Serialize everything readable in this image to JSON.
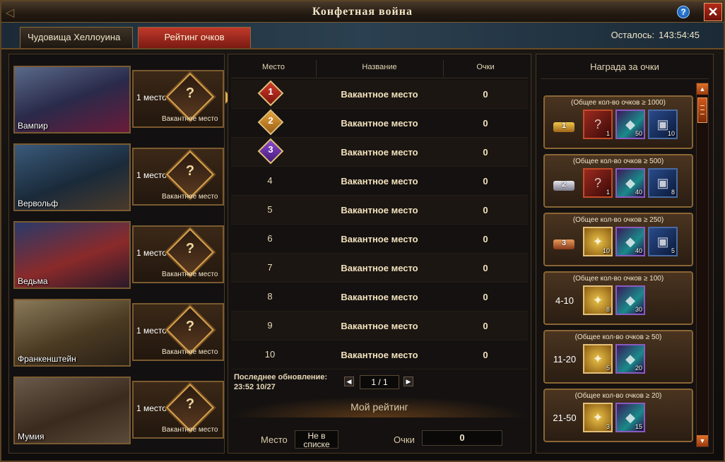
{
  "window": {
    "title": "Конфетная война"
  },
  "tabs": {
    "monsters": "Чудовища Хеллоуина",
    "rating": "Рейтинг очков"
  },
  "remaining": {
    "label": "Осталось:",
    "value": "143:54:45"
  },
  "monsters": [
    {
      "name": "Вампир",
      "place": "1 место",
      "status": "Вакантное место",
      "mark": "?"
    },
    {
      "name": "Вервольф",
      "place": "1 место",
      "status": "Вакантное место",
      "mark": "?"
    },
    {
      "name": "Ведьма",
      "place": "1 место",
      "status": "Вакантное место",
      "mark": "?"
    },
    {
      "name": "Франкенштейн",
      "place": "1 место",
      "status": "Вакантное место",
      "mark": "?"
    },
    {
      "name": "Мумия",
      "place": "1 место",
      "status": "Вакантное место",
      "mark": "?"
    }
  ],
  "table": {
    "headers": {
      "place": "Место",
      "name": "Название",
      "score": "Очки"
    },
    "rows": [
      {
        "rank": "1",
        "name": "Вакантное место",
        "score": "0"
      },
      {
        "rank": "2",
        "name": "Вакантное место",
        "score": "0"
      },
      {
        "rank": "3",
        "name": "Вакантное место",
        "score": "0"
      },
      {
        "rank": "4",
        "name": "Вакантное место",
        "score": "0"
      },
      {
        "rank": "5",
        "name": "Вакантное место",
        "score": "0"
      },
      {
        "rank": "6",
        "name": "Вакантное место",
        "score": "0"
      },
      {
        "rank": "7",
        "name": "Вакантное место",
        "score": "0"
      },
      {
        "rank": "8",
        "name": "Вакантное место",
        "score": "0"
      },
      {
        "rank": "9",
        "name": "Вакантное место",
        "score": "0"
      },
      {
        "rank": "10",
        "name": "Вакантное место",
        "score": "0"
      }
    ]
  },
  "update": {
    "label": "Последнее обновление:",
    "time": "23:52 10/27"
  },
  "pager": {
    "page": "1 / 1"
  },
  "my_rating": {
    "title": "Мой рейтинг",
    "place_label": "Место",
    "place_line1": "Не в",
    "place_line2": "списке",
    "score_label": "Очки",
    "score": "0"
  },
  "rewards": {
    "title": "Награда за очки",
    "tiers": [
      {
        "cond": "(Общее кол-во очков ≥ 1000)",
        "label": "1",
        "crown": "gold",
        "items": [
          {
            "type": "scroll",
            "qty": "1",
            "icon": "scroll-icon"
          },
          {
            "type": "crystal",
            "qty": "50",
            "icon": "crystal-icon"
          },
          {
            "type": "chest",
            "qty": "10",
            "icon": "chest-icon"
          }
        ]
      },
      {
        "cond": "(Общее кол-во очков ≥ 500)",
        "label": "2",
        "crown": "silver",
        "items": [
          {
            "type": "scroll",
            "qty": "1",
            "icon": "scroll-icon"
          },
          {
            "type": "crystal",
            "qty": "40",
            "icon": "crystal-icon"
          },
          {
            "type": "chest",
            "qty": "8",
            "icon": "chest-icon"
          }
        ]
      },
      {
        "cond": "(Общее кол-во очков ≥ 250)",
        "label": "3",
        "crown": "bronze",
        "items": [
          {
            "type": "gold",
            "qty": "10",
            "icon": "gold-orb-icon"
          },
          {
            "type": "crystal",
            "qty": "40",
            "icon": "crystal-icon"
          },
          {
            "type": "chest",
            "qty": "5",
            "icon": "chest-icon"
          }
        ]
      },
      {
        "cond": "(Общее кол-во очков ≥ 100)",
        "label": "4-10",
        "crown": "",
        "items": [
          {
            "type": "gold",
            "qty": "8",
            "icon": "gold-orb-icon"
          },
          {
            "type": "crystal",
            "qty": "30",
            "icon": "crystal-icon"
          }
        ]
      },
      {
        "cond": "(Общее кол-во очков ≥ 50)",
        "label": "11-20",
        "crown": "",
        "items": [
          {
            "type": "gold",
            "qty": "5",
            "icon": "gold-orb-icon"
          },
          {
            "type": "crystal",
            "qty": "20",
            "icon": "crystal-icon"
          }
        ]
      },
      {
        "cond": "(Общее кол-во очков ≥ 20)",
        "label": "21-50",
        "crown": "",
        "items": [
          {
            "type": "gold",
            "qty": "3",
            "icon": "gold-orb-icon"
          },
          {
            "type": "crystal",
            "qty": "15",
            "icon": "crystal-icon"
          }
        ]
      }
    ]
  },
  "colors": {
    "accent_red": "#c0392b",
    "gold": "#d7a34c",
    "frame": "#7a5a30"
  }
}
